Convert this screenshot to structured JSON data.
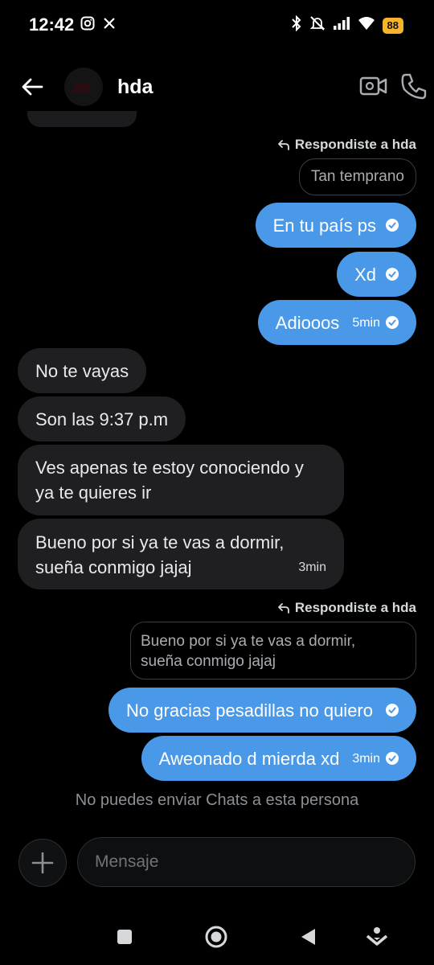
{
  "status_bar": {
    "time": "12:42",
    "battery": "88",
    "left_icons": [
      "instagram-icon",
      "x-icon"
    ],
    "right_icons": [
      "bluetooth-icon",
      "mute-icon",
      "signal-icon",
      "wifi-icon"
    ]
  },
  "header": {
    "contact_name": "hda",
    "icons": [
      "back-arrow-icon",
      "video-call-icon",
      "phone-icon"
    ]
  },
  "messages": [
    {
      "type": "reply_label",
      "text": "Respondiste a hda"
    },
    {
      "type": "quoted",
      "text": "Tan temprano"
    },
    {
      "type": "sent",
      "text": "En tu país ps",
      "read": true
    },
    {
      "type": "sent",
      "text": "Xd",
      "read": true
    },
    {
      "type": "sent",
      "text": "Adiooos",
      "time": "5min",
      "read": true
    },
    {
      "type": "received",
      "text": "No te vayas"
    },
    {
      "type": "received",
      "text": "Son las 9:37 p.m"
    },
    {
      "type": "received",
      "line1": "Ves apenas te estoy conociendo y",
      "line2": "ya te quieres ir"
    },
    {
      "type": "received",
      "line1": "Bueno por si ya te vas a dormir,",
      "line2": "sueña conmigo jajaj",
      "time": "3min"
    },
    {
      "type": "reply_label",
      "text": "Respondiste a hda"
    },
    {
      "type": "quoted",
      "line1": "Bueno por si ya te vas a dormir,",
      "line2": "sueña conmigo jajaj"
    },
    {
      "type": "sent",
      "text": "No gracias pesadillas no quiero",
      "read": true
    },
    {
      "type": "sent",
      "text": "Aweonado d mierda xd",
      "time": "3min",
      "read": true
    }
  ],
  "notice": "No puedes enviar Chats a esta persona",
  "composer": {
    "placeholder": "Mensaje",
    "add_icon": "plus-icon"
  },
  "nav_bar": {
    "icons": [
      "recents-square-icon",
      "home-circle-icon",
      "back-triangle-icon",
      "assistant-icon"
    ]
  },
  "colors": {
    "background": "#000000",
    "sent_bubble": "#4a99e9",
    "received_bubble": "#1f1f21",
    "battery": "#f7b32b"
  }
}
